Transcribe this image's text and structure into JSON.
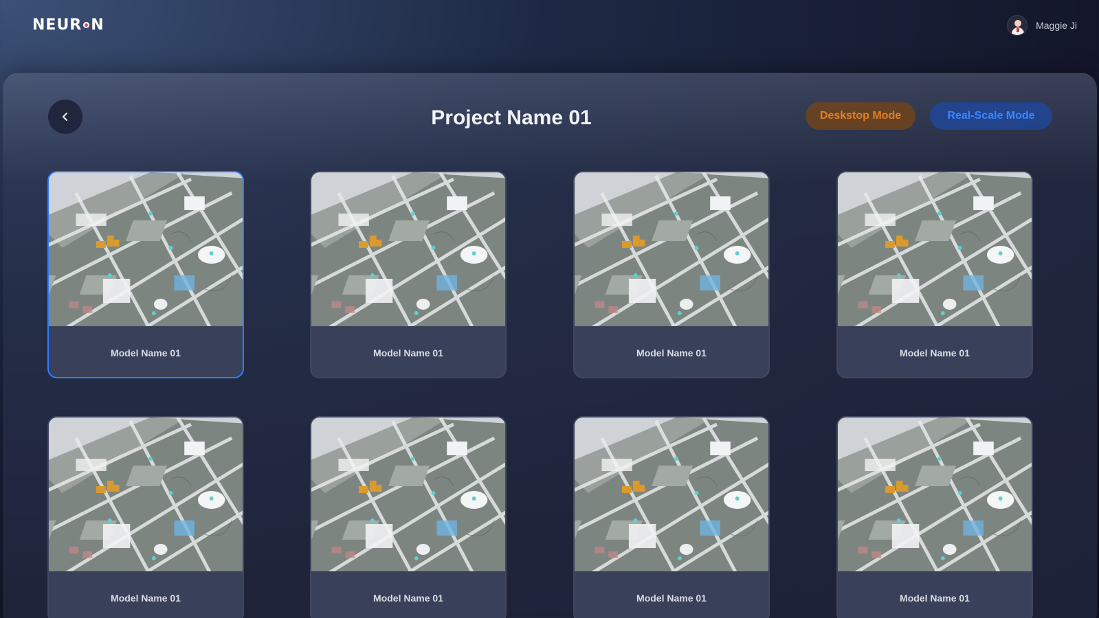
{
  "header": {
    "logo_left": "NEUR",
    "logo_right": "N",
    "user_name": "Maggie Ji"
  },
  "page": {
    "title": "Project Name 01",
    "modes": {
      "desktop_label": "Deskstop Mode",
      "real_scale_label": "Real-Scale Mode"
    }
  },
  "models": [
    {
      "name": "Model Name 01",
      "selected": true
    },
    {
      "name": "Model Name 01",
      "selected": false
    },
    {
      "name": "Model Name 01",
      "selected": false
    },
    {
      "name": "Model Name 01",
      "selected": false
    },
    {
      "name": "Model Name 01",
      "selected": false
    },
    {
      "name": "Model Name 01",
      "selected": false
    },
    {
      "name": "Model Name 01",
      "selected": false
    },
    {
      "name": "Model Name 01",
      "selected": false
    }
  ],
  "colors": {
    "accent_selected": "#2f7cff",
    "desktop_mode_text": "#e27f26",
    "real_scale_mode_text": "#3a86ff"
  }
}
